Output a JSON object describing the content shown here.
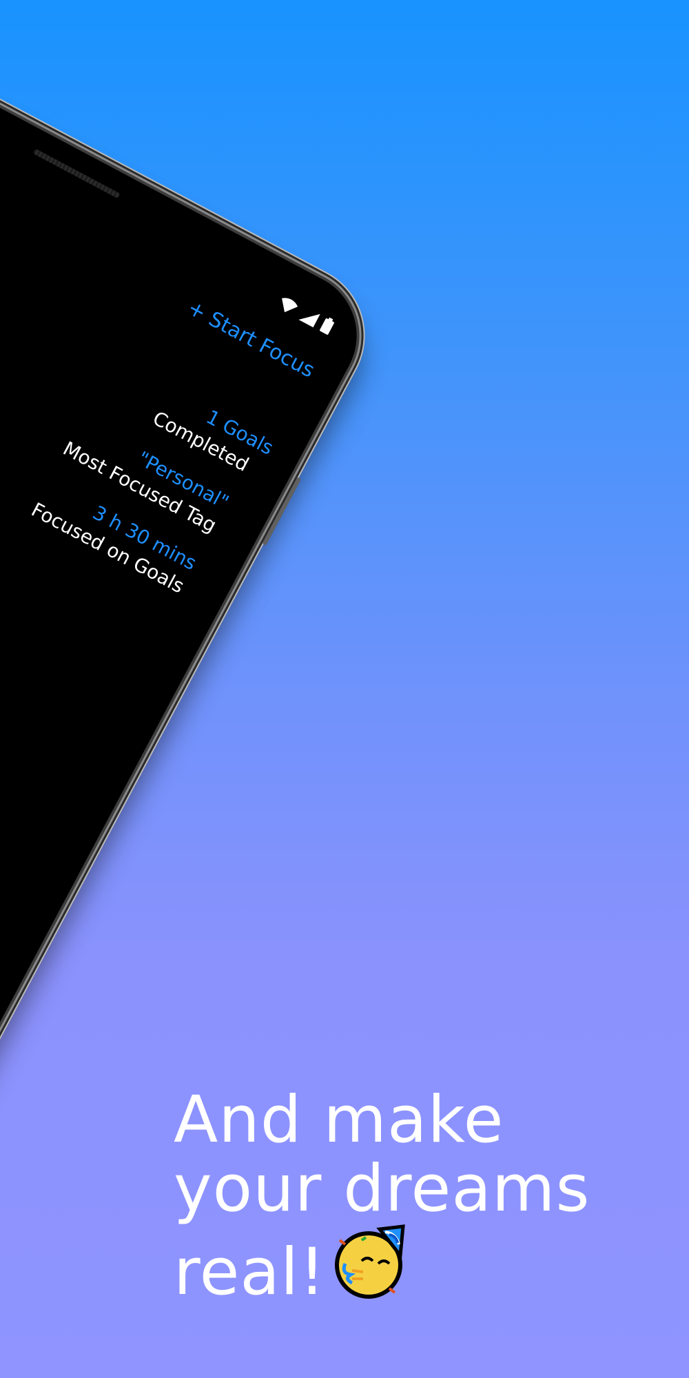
{
  "screen": {
    "start_focus_label": "+ Start Focus",
    "stats": [
      {
        "value": "1 Goals",
        "label": "Completed"
      },
      {
        "value": "\"Personal\"",
        "label": "Most Focused Tag"
      },
      {
        "value": "3 h 30 mins",
        "label": "Focused on Goals"
      }
    ]
  },
  "headline": {
    "line1": "And make",
    "line2": "your dreams",
    "line3": "real!",
    "emoji_icon": "partying-face-icon"
  },
  "colors": {
    "background_top": "#1893ff",
    "background_bottom": "#8f94ff",
    "accent_blue": "#1e8fff",
    "text_white": "#ffffff"
  }
}
